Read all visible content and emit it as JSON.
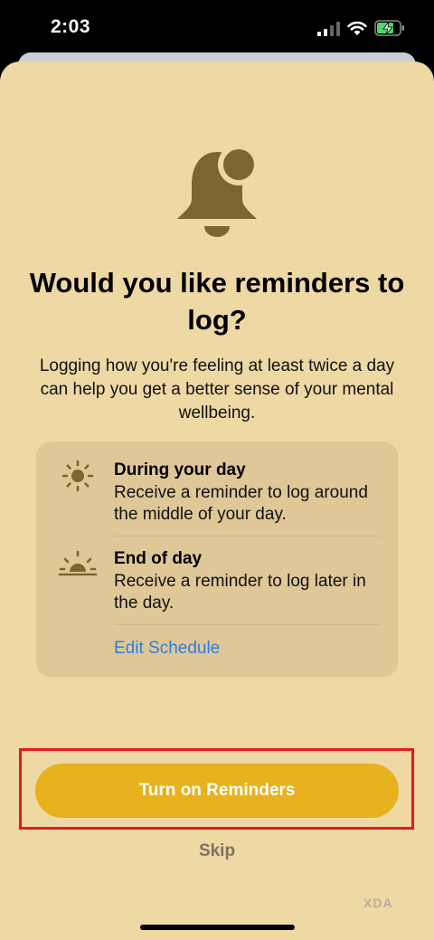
{
  "status_bar": {
    "time": "2:03",
    "icons": [
      "cellular-signal-icon",
      "wifi-icon",
      "battery-charging-icon"
    ]
  },
  "sheet": {
    "icon": "bell-badge-icon",
    "title": "Would you like reminders to log?",
    "subtitle": "Logging how you're feeling at least twice a day can help you get a better sense of your mental wellbeing.",
    "options": [
      {
        "icon": "sun-icon",
        "title": "During your day",
        "description": "Receive a reminder to log around the middle of your day."
      },
      {
        "icon": "sunset-icon",
        "title": "End of day",
        "description": "Receive a reminder to log later in the day."
      }
    ],
    "edit_link": "Edit Schedule",
    "primary_button": "Turn on Reminders",
    "skip": "Skip"
  },
  "watermark": "XDA",
  "colors": {
    "sheet_background": "#eed8a4",
    "card_background": "#dfc798",
    "accent_button": "#e8b11e",
    "link": "#2f7ed8",
    "icon_brown": "#7d6433",
    "highlight": "#e41b1b"
  }
}
